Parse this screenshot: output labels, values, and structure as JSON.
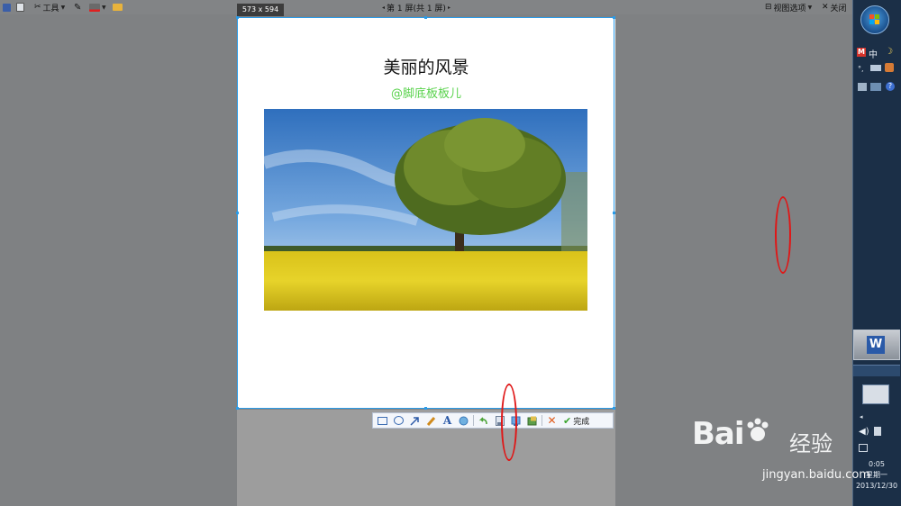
{
  "toolbar": {
    "tools_label": "工具",
    "page_nav": "第 1 屏(共 1 屏)",
    "view_options": "视图选项",
    "close": "关闭"
  },
  "selection": {
    "size_label": "573 x 594"
  },
  "document": {
    "title": "美丽的风景",
    "author": "@脚底板板儿"
  },
  "annotation_toolbar": {
    "done_label": "完成",
    "tools": [
      "rectangle-icon",
      "ellipse-icon",
      "arrow-icon",
      "brush-icon",
      "text-icon",
      "mosaic-icon",
      "undo-icon",
      "save-icon",
      "copy-icon",
      "pin-icon",
      "cancel-icon"
    ]
  },
  "taskbar": {
    "ime_label": "中",
    "time": "0:05",
    "weekday": "星期一",
    "date": "2013/12/30"
  },
  "watermark": {
    "text": "Bai",
    "text2": "经验",
    "url": "jingyan.baidu.com"
  },
  "colors": {
    "selection_border": "#2a9be8",
    "author_text": "#58d24b",
    "annotation_red": "#e01616",
    "taskbar_bg": "#1b2f47"
  }
}
